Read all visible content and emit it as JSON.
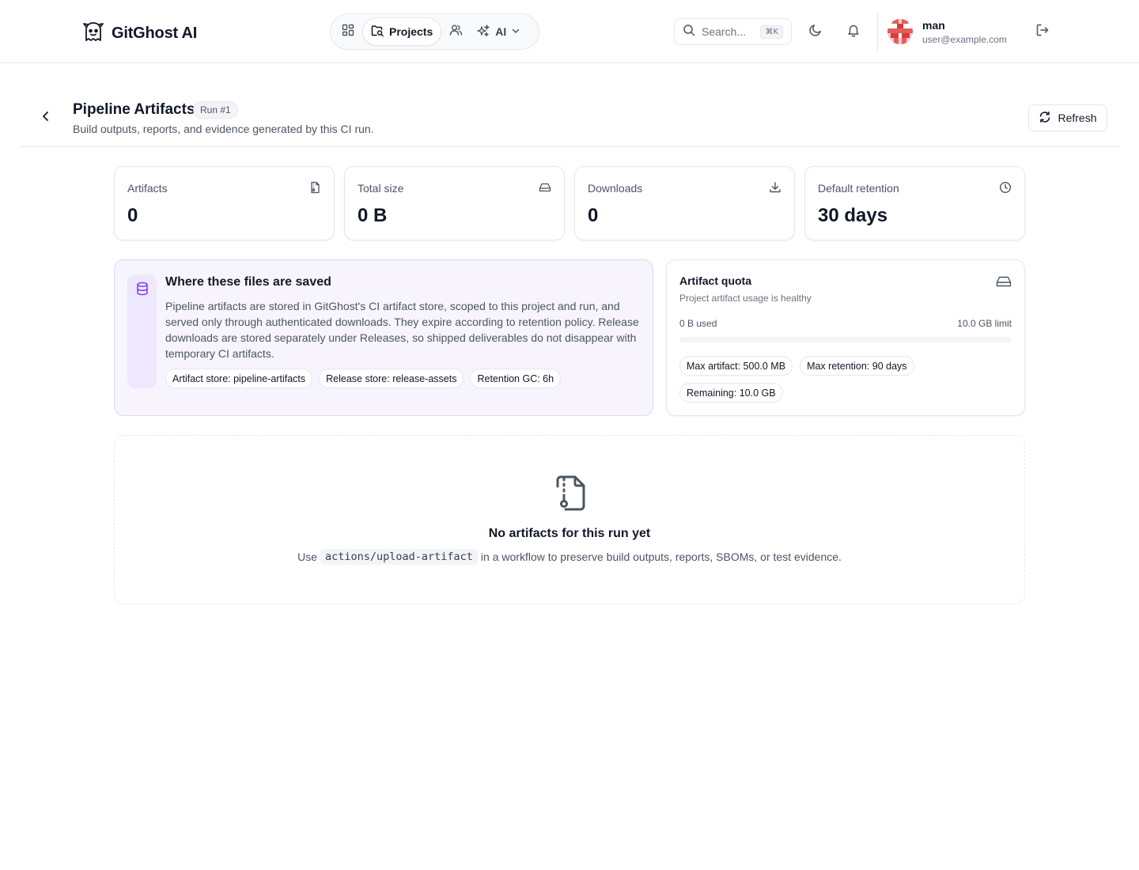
{
  "header": {
    "app_name": "GitGhost AI",
    "nav": {
      "projects_label": "Projects",
      "ai_label": "AI"
    },
    "search": {
      "placeholder": "Search...",
      "shortcut": "⌘K"
    },
    "user": {
      "name": "man",
      "email": "user@example.com"
    }
  },
  "page": {
    "title": "Pipeline Artifacts",
    "run_badge": "Run #1",
    "subtitle": "Build outputs, reports, and evidence generated by this CI run.",
    "refresh_label": "Refresh"
  },
  "stats": [
    {
      "label": "Artifacts",
      "value": "0",
      "icon": "file-archive-icon"
    },
    {
      "label": "Total size",
      "value": "0 B",
      "icon": "hard-drive-icon"
    },
    {
      "label": "Downloads",
      "value": "0",
      "icon": "download-icon"
    },
    {
      "label": "Default retention",
      "value": "30 days",
      "icon": "clock-icon"
    }
  ],
  "storage_info": {
    "title": "Where these files are saved",
    "body": "Pipeline artifacts are stored in GitGhost's CI artifact store, scoped to this project and run, and served only through authenticated downloads. They expire according to retention policy. Release downloads are stored separately under Releases, so shipped deliverables do not disappear with temporary CI artifacts.",
    "chips": [
      "Artifact store: pipeline-artifacts",
      "Release store: release-assets",
      "Retention GC: 6h"
    ]
  },
  "quota": {
    "title": "Artifact quota",
    "subtitle": "Project artifact usage is healthy",
    "used": "0 B used",
    "limit": "10.0 GB limit",
    "usage_fraction": 0,
    "chips": [
      "Max artifact: 500.0 MB",
      "Max retention: 90 days",
      "Remaining: 10.0 GB"
    ]
  },
  "empty_state": {
    "title": "No artifacts for this run yet",
    "desc_before": "Use",
    "code": "actions/upload-artifact",
    "desc_after": "in a workflow to preserve build outputs, reports, SBOMs, or test evidence."
  },
  "colors": {
    "accent": "#7c3aed",
    "info_bg": "#f7f4fe",
    "border": "#e5e7eb"
  }
}
